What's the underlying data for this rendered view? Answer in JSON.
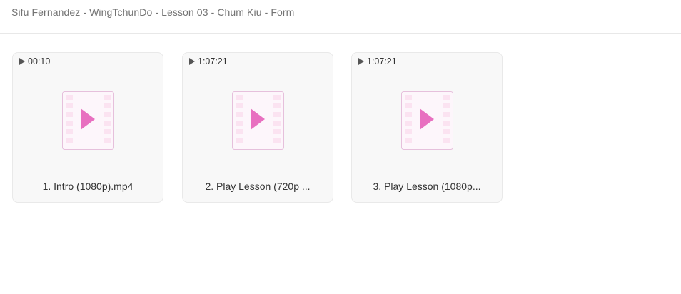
{
  "breadcrumb": "Sifu Fernandez - WingTchunDo - Lesson 03 - Chum Kiu - Form",
  "files": [
    {
      "duration": "00:10",
      "name": "1. Intro (1080p).mp4",
      "icon": "video-file-icon"
    },
    {
      "duration": "1:07:21",
      "name": "2. Play Lesson (720p ...",
      "icon": "video-file-icon"
    },
    {
      "duration": "1:07:21",
      "name": "3. Play Lesson (1080p...",
      "icon": "video-file-icon"
    }
  ],
  "colors": {
    "icon_play": "#e870c0",
    "icon_border": "#e6c0dc",
    "icon_frame": "#fbe3f1"
  }
}
